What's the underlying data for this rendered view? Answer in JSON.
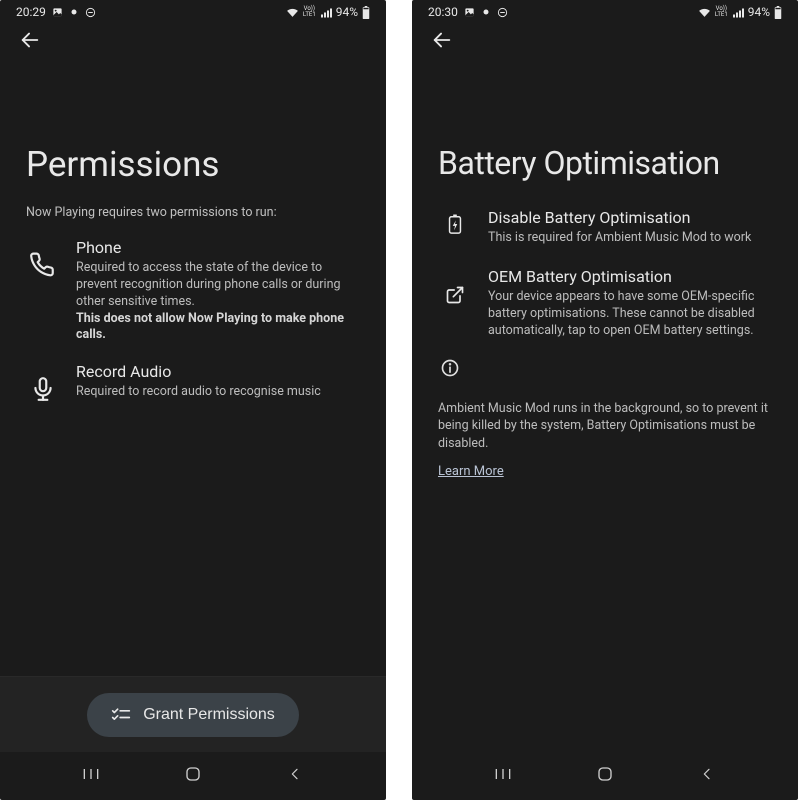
{
  "screens": [
    {
      "statusbar": {
        "time": "20:29",
        "battery": "94%"
      },
      "title": "Permissions",
      "intro": "Now Playing requires two permissions to run:",
      "items": [
        {
          "icon": "phone-icon",
          "title": "Phone",
          "body": "Required to access the state of the device to prevent recognition during phone calls or during other sensitive times.",
          "bold": "This does not allow Now Playing to make phone calls."
        },
        {
          "icon": "mic-icon",
          "title": "Record Audio",
          "body": "Required to record audio to recognise music",
          "bold": ""
        }
      ],
      "grant_label": "Grant Permissions"
    },
    {
      "statusbar": {
        "time": "20:30",
        "battery": "94%"
      },
      "title": "Battery Optimisation",
      "items": [
        {
          "icon": "battery-icon",
          "title": "Disable Battery Optimisation",
          "body": "This is required for Ambient Music Mod to work"
        },
        {
          "icon": "open-external-icon",
          "title": "OEM Battery Optimisation",
          "body": "Your device appears to have some OEM-specific battery optimisations. These cannot be disabled automatically, tap to open OEM battery settings."
        }
      ],
      "info_body": "Ambient Music Mod runs in the background, so to prevent it being killed by the system, Battery Optimisations must be disabled.",
      "learn_more": "Learn More"
    }
  ]
}
